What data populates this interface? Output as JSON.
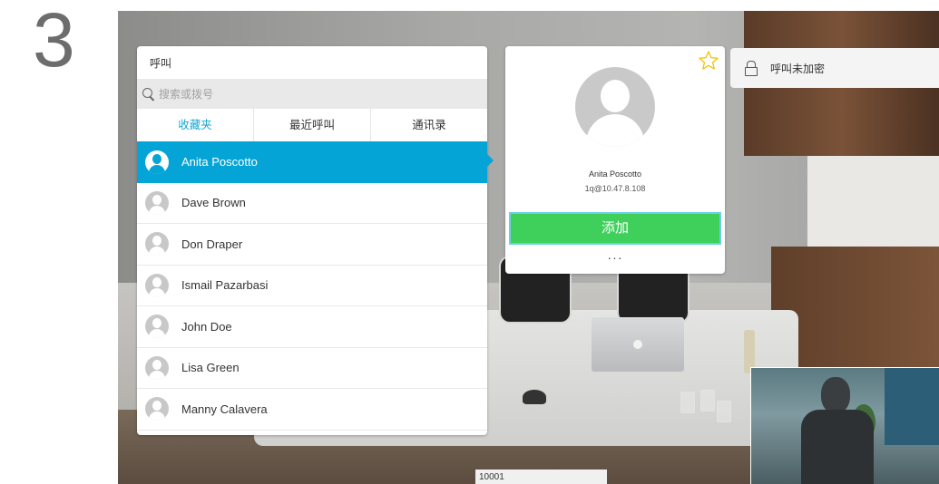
{
  "step": {
    "number": "3"
  },
  "call_panel": {
    "title": "呼叫",
    "search": {
      "placeholder": "搜索或拨号"
    },
    "tabs": [
      {
        "label": "收藏夹",
        "active": true
      },
      {
        "label": "最近呼叫",
        "active": false
      },
      {
        "label": "通讯录",
        "active": false
      }
    ],
    "contacts": [
      {
        "name": "Anita Poscotto",
        "selected": true
      },
      {
        "name": "Dave Brown",
        "selected": false
      },
      {
        "name": "Don Draper",
        "selected": false
      },
      {
        "name": "Ismail Pazarbasi",
        "selected": false
      },
      {
        "name": "John Doe",
        "selected": false
      },
      {
        "name": "Lisa Green",
        "selected": false
      },
      {
        "name": "Manny Calavera",
        "selected": false
      }
    ]
  },
  "contact_card": {
    "name": "Anita Poscotto",
    "address": "1q@10.47.8.108",
    "add_label": "添加",
    "more_label": "···"
  },
  "encryption": {
    "label": "呼叫未加密"
  },
  "video": {
    "caption": "10001"
  },
  "colors": {
    "accent": "#05a4d6",
    "tab_active": "#17a7d3",
    "add_button": "#3fcf5b",
    "star": "#f2c200"
  }
}
